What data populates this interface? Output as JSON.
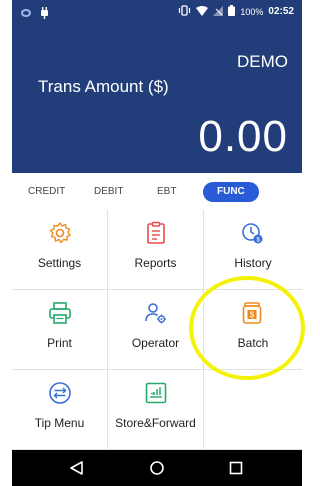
{
  "status": {
    "battery": "100%",
    "time": "02:52",
    "icons": [
      "app-icon",
      "notification-icon",
      "vibrate-icon",
      "wifi-icon",
      "no-signal-icon",
      "battery-icon"
    ]
  },
  "header": {
    "mode": "DEMO",
    "amount_label": "Trans Amount ($)",
    "amount": "0.00"
  },
  "tabs": [
    {
      "label": "CREDIT",
      "active": false
    },
    {
      "label": "DEBIT",
      "active": false
    },
    {
      "label": "EBT",
      "active": false
    },
    {
      "label": "FUNC",
      "active": true
    }
  ],
  "menu": [
    {
      "label": "Settings",
      "icon": "gear-icon"
    },
    {
      "label": "Reports",
      "icon": "clipboard-icon"
    },
    {
      "label": "History",
      "icon": "history-clock-icon"
    },
    {
      "label": "Print",
      "icon": "printer-icon"
    },
    {
      "label": "Operator",
      "icon": "operator-icon"
    },
    {
      "label": "Batch",
      "icon": "batch-jar-icon"
    },
    {
      "label": "Tip Menu",
      "icon": "tip-menu-icon"
    },
    {
      "label": "Store&Forward",
      "icon": "store-forward-icon"
    }
  ],
  "nav": {
    "icons": [
      "back-icon",
      "home-icon",
      "recents-icon"
    ]
  },
  "colors": {
    "header_bg": "#223e7a",
    "icon_orange": "#f08a1c",
    "icon_green": "#26a96c",
    "icon_blue": "#3a6fd8",
    "active_tab": "#2a5bd7",
    "highlight": "#f5f20a"
  }
}
